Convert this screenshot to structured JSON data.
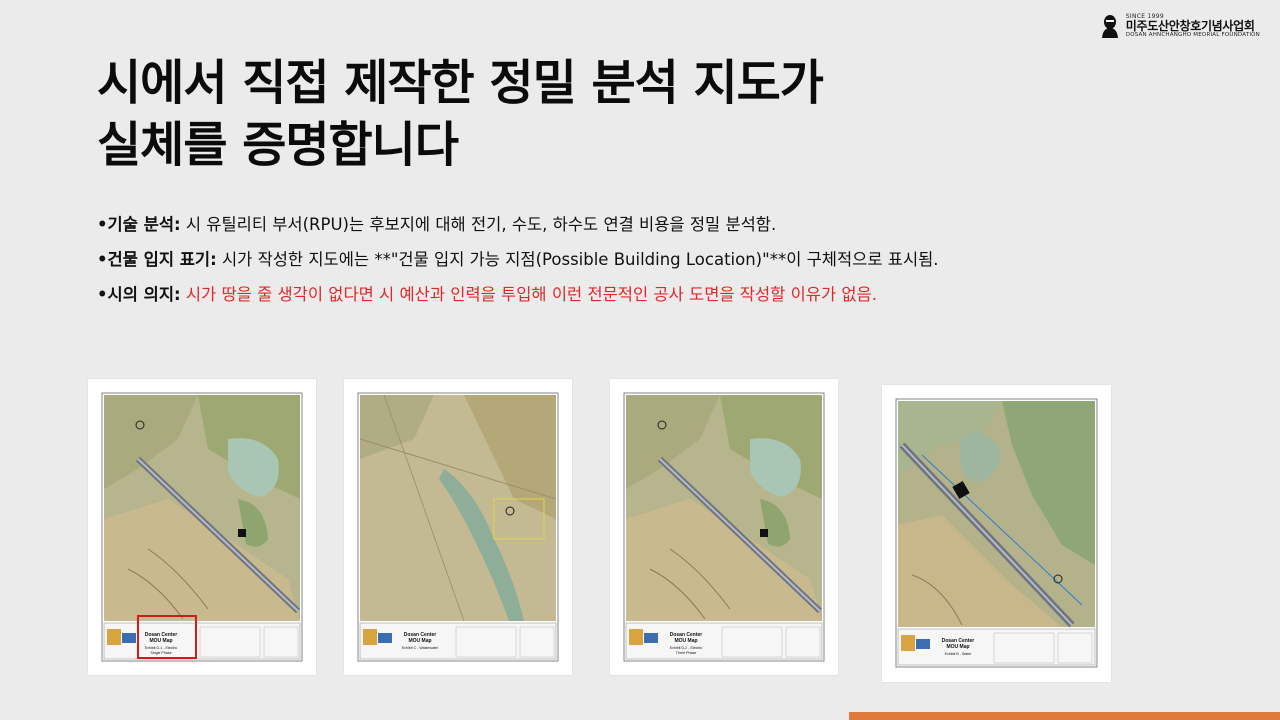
{
  "logo": {
    "since": "SINCE 1999",
    "name_ko": "미주도산안창호기념사업회",
    "name_en": "DOSAN AHNCHANGHO MEORIAL FOUNDATION"
  },
  "title": {
    "line1": "시에서 직접 제작한 정밀 분석 지도가",
    "line2": "실체를 증명합니다"
  },
  "bullets": [
    {
      "label": "•기술 분석:",
      "text": " 시 유틸리티 부서(RPU)는 후보지에 대해 전기, 수도, 하수도 연결 비용을 정밀 분석함."
    },
    {
      "label": "•건물 입지 표기:",
      "text": " 시가 작성한 지도에는 **\"건물 입지 가능 지점(Possible Building Location)\"**이 구체적으로 표시됨."
    },
    {
      "label": "•시의 의지:",
      "text": " 시가 땅을 줄 생각이 없다면 시 예산과 인력을 투입해 이런 전문적인 공사 도면을 작성할 이유가 없음.",
      "highlight": true
    }
  ],
  "maps": [
    {
      "legend_title": "Dosan Center\nMOU Map",
      "exhibit": "Exhibit D-1 - Electric\nSingle Phase",
      "highlighted": true
    },
    {
      "legend_title": "Dosan Center\nMOU Map",
      "exhibit": "Exhibit C - Wastewater",
      "highlighted": false
    },
    {
      "legend_title": "Dosan Center\nMOU Map",
      "exhibit": "Exhibit D-2 - Electric\nThree Phase",
      "highlighted": false
    },
    {
      "legend_title": "Dosan Center\nMOU Map",
      "exhibit": "Exhibit B - Water",
      "highlighted": false
    }
  ],
  "colors": {
    "accent": "#e07a3c",
    "highlight_text": "#e0282a",
    "highlight_box": "#d01c1c",
    "background": "#ebebeb"
  }
}
